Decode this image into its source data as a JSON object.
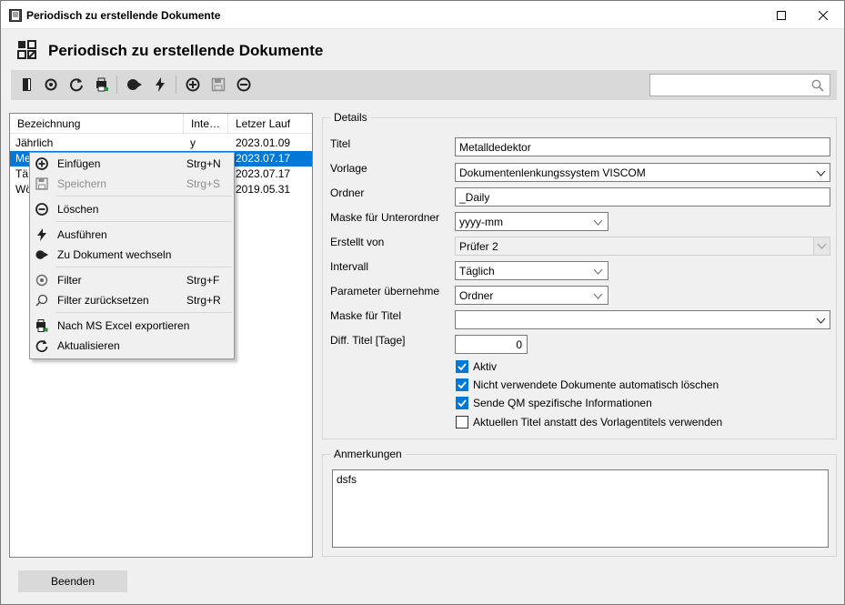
{
  "window": {
    "title": "Periodisch zu erstellende Dokumente"
  },
  "header": {
    "title": "Periodisch zu erstellende Dokumente"
  },
  "toolbar": {
    "icons": [
      "exit-icon",
      "filter-reset-icon",
      "refresh-icon",
      "excel-export-icon",
      "goto-document-icon",
      "execute-icon",
      "add-icon",
      "save-icon",
      "delete-icon"
    ],
    "search": {
      "value": "",
      "placeholder": ""
    }
  },
  "grid": {
    "columns": [
      "Bezeichnung",
      "Inte…",
      "Letzer Lauf"
    ],
    "rows": [
      {
        "name": "Jährlich",
        "interval": "y",
        "last_run": "2023.01.09"
      },
      {
        "name": "Me",
        "interval": "",
        "last_run": "2023.07.17"
      },
      {
        "name": "Tä",
        "interval": "",
        "last_run": "2023.07.17"
      },
      {
        "name": "Wö",
        "interval": "",
        "last_run": "2019.05.31"
      }
    ]
  },
  "context_menu": {
    "items": [
      {
        "label": "Einfügen",
        "shortcut": "Strg+N"
      },
      {
        "label": "Speichern",
        "shortcut": "Strg+S"
      },
      {
        "label": "Löschen",
        "shortcut": ""
      },
      {
        "label": "Ausführen",
        "shortcut": ""
      },
      {
        "label": "Zu Dokument wechseln",
        "shortcut": ""
      },
      {
        "label": "Filter",
        "shortcut": "Strg+F"
      },
      {
        "label": "Filter zurücksetzen",
        "shortcut": "Strg+R"
      },
      {
        "label": "Nach MS Excel exportieren",
        "shortcut": ""
      },
      {
        "label": "Aktualisieren",
        "shortcut": ""
      }
    ]
  },
  "details": {
    "legend": "Details",
    "fields": {
      "titel": {
        "label": "Titel",
        "value": "Metalldedektor"
      },
      "vorlage": {
        "label": "Vorlage",
        "value": "Dokumentenlenkungssystem VISCOM"
      },
      "ordner": {
        "label": "Ordner",
        "value": "_Daily"
      },
      "maske_unterordner": {
        "label": "Maske für Unterordner",
        "value": "yyyy-mm"
      },
      "erstellt_von": {
        "label": "Erstellt von",
        "value": "Prüfer 2"
      },
      "intervall": {
        "label": "Intervall",
        "value": "Täglich"
      },
      "parameter": {
        "label": "Parameter übernehmen",
        "value": "Ordner"
      },
      "maske_titel": {
        "label": "Maske für Titel",
        "value": ""
      },
      "diff_titel": {
        "label": "Diff. Titel [Tage]",
        "value": "0"
      }
    },
    "checkboxes": [
      {
        "label": "Aktiv",
        "checked": true
      },
      {
        "label": "Nicht verwendete Dokumente automatisch löschen",
        "checked": true
      },
      {
        "label": "Sende QM spezifische Informationen",
        "checked": true
      },
      {
        "label": "Aktuellen Titel anstatt des Vorlagentitels verwenden",
        "checked": false
      }
    ]
  },
  "remarks": {
    "legend": "Anmerkungen",
    "value": "dsfs"
  },
  "footer": {
    "end_label": "Beenden"
  },
  "colors": {
    "accent": "#0078d7",
    "toolbar_bg": "#d9d9d9",
    "window_bg": "#f0f0f0"
  }
}
